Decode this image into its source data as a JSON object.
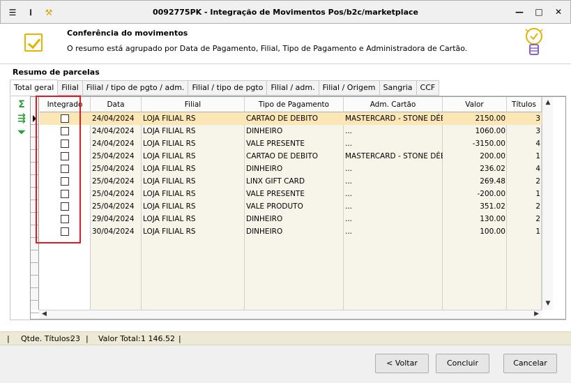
{
  "window": {
    "title": "0092775PK - Integração de Movimentos Pos/b2c/marketplace",
    "controls": [
      "—",
      "□",
      "✕"
    ]
  },
  "header": {
    "title": "Conferência do movimentos",
    "subtitle": "O resumo está agrupado por Data de Pagamento, Filial, Tipo de Pagamento e Administradora de Cartão."
  },
  "section_label": "Resumo de parcelas",
  "tabs": [
    {
      "label": "Total geral"
    },
    {
      "label": "Filial"
    },
    {
      "label": "Filial / tipo de pgto / adm."
    },
    {
      "label": "Filial / tipo de pgto"
    },
    {
      "label": "Filial / adm."
    },
    {
      "label": "Filial / Origem"
    },
    {
      "label": "Sangria"
    },
    {
      "label": "CCF"
    }
  ],
  "grid": {
    "columns": [
      "Integrado",
      "Data",
      "Filial",
      "Tipo de Pagamento",
      "Adm. Cartão",
      "Valor",
      "Títulos"
    ],
    "rows": [
      {
        "integrado": false,
        "data": "24/04/2024",
        "filial": "LOJA FILIAL RS",
        "tipo": "CARTAO DE DEBITO",
        "adm": "MASTERCARD -  STONE DÉBI",
        "valor": "2150.00",
        "titulos": "3"
      },
      {
        "integrado": false,
        "data": "24/04/2024",
        "filial": "LOJA FILIAL RS",
        "tipo": "DINHEIRO",
        "adm": "...",
        "valor": "1060.00",
        "titulos": "3"
      },
      {
        "integrado": false,
        "data": "24/04/2024",
        "filial": "LOJA FILIAL RS",
        "tipo": "VALE PRESENTE",
        "adm": "...",
        "valor": "-3150.00",
        "titulos": "4"
      },
      {
        "integrado": false,
        "data": "25/04/2024",
        "filial": "LOJA FILIAL RS",
        "tipo": "CARTAO DE DEBITO",
        "adm": "MASTERCARD -  STONE DÉBI",
        "valor": "200.00",
        "titulos": "1"
      },
      {
        "integrado": false,
        "data": "25/04/2024",
        "filial": "LOJA FILIAL RS",
        "tipo": "DINHEIRO",
        "adm": "...",
        "valor": "236.02",
        "titulos": "4"
      },
      {
        "integrado": false,
        "data": "25/04/2024",
        "filial": "LOJA FILIAL RS",
        "tipo": "LINX GIFT CARD",
        "adm": "...",
        "valor": "269.48",
        "titulos": "2"
      },
      {
        "integrado": false,
        "data": "25/04/2024",
        "filial": "LOJA FILIAL RS",
        "tipo": "VALE PRESENTE",
        "adm": "...",
        "valor": "-200.00",
        "titulos": "1"
      },
      {
        "integrado": false,
        "data": "25/04/2024",
        "filial": "LOJA FILIAL RS",
        "tipo": "VALE PRODUTO",
        "adm": "...",
        "valor": "351.02",
        "titulos": "2"
      },
      {
        "integrado": false,
        "data": "29/04/2024",
        "filial": "LOJA FILIAL RS",
        "tipo": "DINHEIRO",
        "adm": "...",
        "valor": "130.00",
        "titulos": "2"
      },
      {
        "integrado": false,
        "data": "30/04/2024",
        "filial": "LOJA FILIAL RS",
        "tipo": "DINHEIRO",
        "adm": "...",
        "valor": "100.00",
        "titulos": "1"
      }
    ]
  },
  "status": {
    "qtde_label": "Qtde. Títulos:",
    "qtde_value": "23",
    "total_label": "Valor Total:",
    "total_value": "1 146.52"
  },
  "buttons": {
    "back": "< Voltar",
    "finish": "Concluir",
    "cancel": "Cancelar"
  },
  "colors": {
    "selected_row": "#fbe6b5",
    "highlight_box": "#e0191f",
    "status_bar": "#ede9d4",
    "tool_icons": "#2b9f3a"
  }
}
